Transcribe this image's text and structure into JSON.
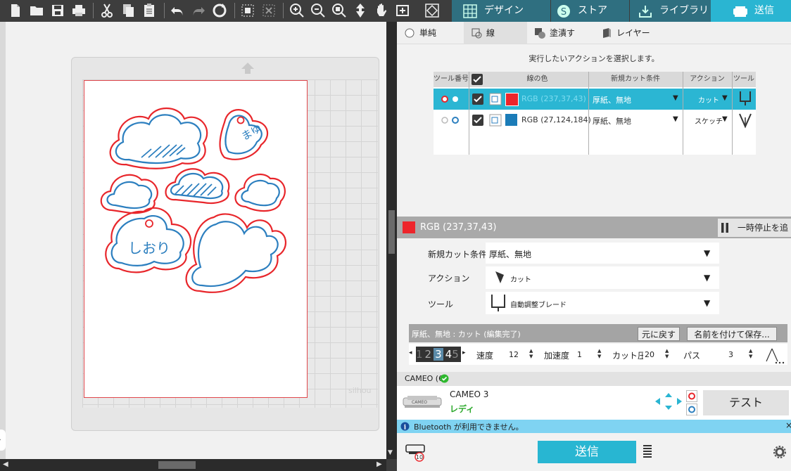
{
  "topbar": {
    "tabs": [
      {
        "label": "デザイン",
        "icon": "grid-icon"
      },
      {
        "label": "ストア",
        "icon": "store-s-icon"
      },
      {
        "label": "ライブラリ",
        "icon": "library-download-icon"
      },
      {
        "label": "送信",
        "icon": "cutter-send-icon"
      }
    ]
  },
  "subtabs": [
    {
      "label": "単純",
      "icon": "radio-icon"
    },
    {
      "label": "線",
      "icon": "line-shape-icon"
    },
    {
      "label": "塗潰す",
      "icon": "fill-shape-icon"
    },
    {
      "label": "レイヤー",
      "icon": "layers-icon"
    }
  ],
  "instruction": "実行したいアクションを選択します。",
  "table": {
    "headers": [
      "ツール番号",
      "",
      "線の色",
      "新規カット条件",
      "アクション",
      "ツール"
    ],
    "rows": [
      {
        "color_label": "RGB (237,37,43)",
        "color": "#ED252B",
        "material": "厚紙、無地",
        "action": "カット",
        "tool_icon": "blade-icon",
        "selected": true
      },
      {
        "color_label": "RGB (27,124,184)",
        "color": "#1B7CB8",
        "material": "厚紙、無地",
        "action": "スケッチ",
        "tool_icon": "pen-icon",
        "selected": false
      }
    ]
  },
  "selected_color": {
    "label": "RGB (237,37,43)",
    "color": "#ED252B"
  },
  "pause_label": "一時停止を追",
  "settings": {
    "material_label": "新規カット条件",
    "material_value": "厚紙、無地",
    "action_label": "アクション",
    "action_value": "カット",
    "tool_label": "ツール",
    "tool_value": "自動調整ブレード"
  },
  "edit_bar": {
    "status": "厚紙、無地 : カット (編集完了)",
    "revert_label": "元に戻す",
    "save_as_label": "名前を付けて保存..."
  },
  "params": {
    "blade_digits": [
      "1",
      "2",
      "3",
      "4",
      "5"
    ],
    "speed_label": "速度",
    "speed": "12",
    "accel_label": "加速度",
    "accel": "1",
    "force_label": "カット圧",
    "force": "20",
    "passes_label": "パス",
    "passes": "3"
  },
  "device_group": "CAMEO (6)",
  "device": {
    "name": "CAMEO 3",
    "status": "レディ",
    "machine_label": "CAMEO"
  },
  "test_label": "テスト",
  "bluetooth_message": "Bluetooth が利用できません。",
  "send_label": "送信",
  "queue_count": "10",
  "canvas": {
    "label_bookmark": "しおり",
    "label_mayu": "まゆ",
    "watermark": "silhou",
    "cut_color": "#E8262B",
    "sketch_color": "#2C7FBF"
  },
  "colors": {
    "accent": "#2BB6D3",
    "toolbar": "#3D3D3D",
    "tab": "#2F6F80"
  }
}
